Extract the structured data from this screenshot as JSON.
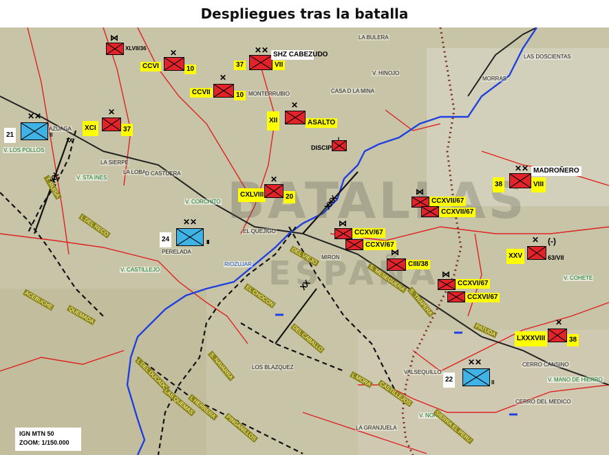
{
  "title": "Despliegues tras la batalla",
  "scale": {
    "line1": "IGN MTN 50",
    "line2": "ZOOM: 1/150.000"
  },
  "colors": {
    "enemy": "#e2232a",
    "friendly": "#3fb2e6",
    "label": "#ffff00",
    "river": "#1f3fe0",
    "road": "#e02020",
    "rail": "#222222"
  },
  "watermark": {
    "line1": "BATALLAS",
    "line2": "ESPAÑA"
  },
  "units": {
    "u_xlvii": {
      "side": "red",
      "echelon": "⋈",
      "tag": "XLVII/36"
    },
    "u_ccvi": {
      "side": "red",
      "echelon": "✕",
      "tag_left": "CCVI",
      "tag_right": "10"
    },
    "u_ccvii": {
      "side": "red",
      "echelon": "✕",
      "tag_left": "CCVII",
      "tag_right": "10"
    },
    "u_37vii": {
      "side": "red",
      "echelon": "✕✕",
      "tag_left": "37",
      "tag_right": "VII",
      "note": "SHZ CABEZUDO"
    },
    "u_xii": {
      "side": "red",
      "echelon": "✕",
      "tag_left": "XII",
      "tag_right": "ASALTO"
    },
    "u_xci": {
      "side": "red",
      "echelon": "✕",
      "tag_left": "XCI",
      "tag_right": "37"
    },
    "u_21": {
      "side": "blue",
      "echelon": "✕✕",
      "tag_left": "21",
      "tag_right": "II"
    },
    "u_discip": {
      "side": "red",
      "echelon": "|",
      "tag_left": "DISCIP"
    },
    "u_cxlviii": {
      "side": "red",
      "echelon": "✕",
      "tag_left": "CXLVIII",
      "tag_right": "20"
    },
    "u_24": {
      "side": "blue",
      "echelon": "✕✕",
      "tag_left": "24",
      "tag_right": "II"
    },
    "u_38viii": {
      "side": "red",
      "echelon": "✕✕",
      "tag_left": "38",
      "tag_right": "VIII",
      "note": "MADROÑERO"
    },
    "u_cxxvii_a": {
      "side": "red",
      "echelon": "⋈",
      "tag": "CCXVII/67"
    },
    "u_cxxvii_b": {
      "side": "red",
      "echelon": "",
      "tag": "CCXVII/67"
    },
    "u_ccxv_a": {
      "side": "red",
      "echelon": "⋈",
      "tag": "CCXV/67"
    },
    "u_ccxv_b": {
      "side": "red",
      "echelon": "",
      "tag": "CCXV/67"
    },
    "u_ciii": {
      "side": "red",
      "echelon": "⋈",
      "tag": "CIII/38"
    },
    "u_xxv": {
      "side": "red",
      "echelon": "✕",
      "tag_left": "XXV",
      "tag_right": "63/VII",
      "note": "(-)"
    },
    "u_ccxvi_a": {
      "side": "red",
      "echelon": "⋈",
      "tag": "CCXVI/67"
    },
    "u_ccxvi_b": {
      "side": "red",
      "echelon": "",
      "tag": "CCXVI/67"
    },
    "u_lxxxviii": {
      "side": "red",
      "echelon": "✕",
      "tag_left": "LXXXVIII",
      "tag_right": "38"
    },
    "u_22": {
      "side": "blue",
      "echelon": "✕✕",
      "tag_left": "22",
      "tag_right": "II"
    }
  },
  "border_labels": {
    "b1": "XX",
    "b2": "XXX",
    "b3": "XX",
    "b4": "XX",
    "b5": "II"
  },
  "places": {
    "la_bulera": "LA BULERA",
    "las_doscientas": "LAS DOSCIENTAS",
    "v_hinojo": "V. HINOJO",
    "morras": "MORRAS",
    "monterrubio": "MONTERRUBIO",
    "casa_mina": "CASA D LA MINA",
    "azuaga": "AZUAGA",
    "v_pollos": "V. LOS POLLOS",
    "la_sierpe": "LA SIERPE",
    "la_loba": "LA LOBA",
    "castuera": "D CASTUERA",
    "v_sta_ines": "V. STA INES",
    "v_corchito": "V. CORCHITO",
    "el_quejigo": "EL QUEJIGO",
    "perelada": "PERELADA",
    "v_castillejo": "V. CASTILLEJO",
    "riozujar": "RIOZUJAR",
    "miron": "MIRON",
    "v_cohete": "V. COHETE",
    "cerro_cansino": "CERRO CANSINO",
    "v_mano": "V. MANO DE HIERRO",
    "cerro_medico": "CERRO DEL MEDICO",
    "valsequillo": "VALSEQUILLO",
    "los_blazquez": "LOS BLAZQUEZ",
    "v_noria": "V. NORIA",
    "la_granjuela": "LA GRANJUELA"
  },
  "roads": {
    "r1": "T. RUISA",
    "r2": "L DEL RECO",
    "r3": "ACEBUCHE",
    "r4": "QUEMADA",
    "r5": "EL CHOCON",
    "r6": "L DEL DUCADO",
    "r7": "LAS QUEMAS",
    "r8": "L HERRERA",
    "r9": "PINGANILLOS",
    "r10": "S. NAVARRA",
    "r11": "DEL VIEJO",
    "r12": "S. MESEGUERA",
    "r13": "S. TRAPERA",
    "r14": "DEL CABALLO",
    "r15": "L MORA",
    "r16": "CASTILLEJOS",
    "r17": "PATUDA",
    "r18": "SIERRA EL PERU"
  }
}
